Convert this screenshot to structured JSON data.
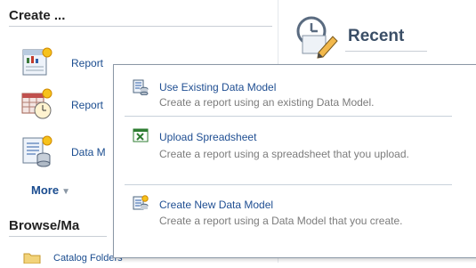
{
  "create": {
    "title": "Create ...",
    "items": [
      {
        "label": "Report",
        "icon": "report-icon"
      },
      {
        "label": "Report",
        "icon": "report-job-icon"
      },
      {
        "label": "Data M",
        "icon": "data-model-icon"
      }
    ],
    "more_label": "More",
    "more_icon": "chevron-down-icon"
  },
  "browse": {
    "title": "Browse/Ma",
    "partial_item": "Catalog Folders",
    "icon": "folder-icon"
  },
  "recent": {
    "title": "Recent",
    "icon": "clock-edit-icon"
  },
  "popup": {
    "items": [
      {
        "title": "Use Existing Data Model",
        "desc": "Create a report using an existing Data Model.",
        "icon": "data-model-icon"
      },
      {
        "title": "Upload Spreadsheet",
        "desc": "Create a report using a spreadsheet that you upload.",
        "icon": "spreadsheet-icon"
      },
      {
        "title": "Create New Data Model",
        "desc": "Create a report using a Data Model that you create.",
        "icon": "new-data-model-icon"
      }
    ]
  },
  "colors": {
    "link": "#1f4e92",
    "desc": "#7c7c7c",
    "popup_border": "#8b97a6",
    "separator": "#c8d1db"
  }
}
